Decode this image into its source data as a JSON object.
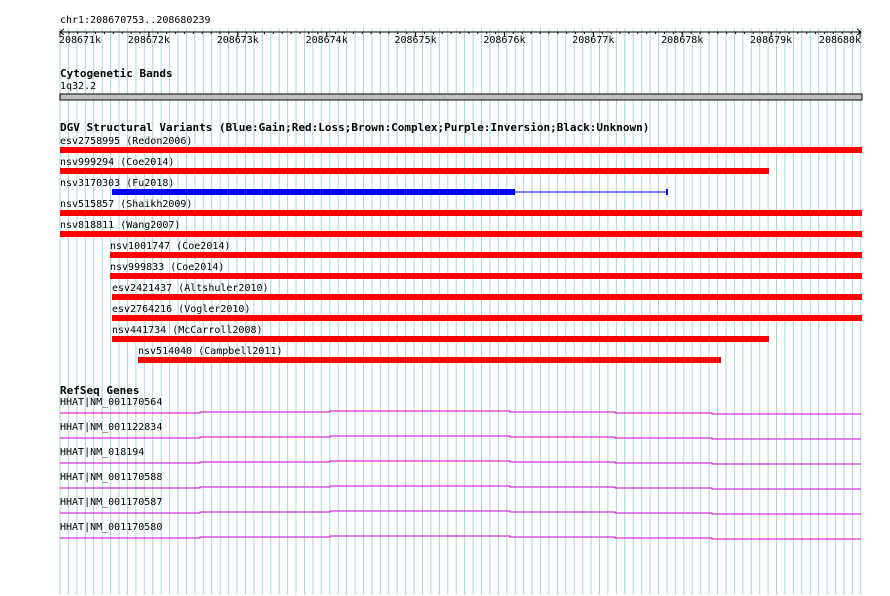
{
  "ruler": {
    "region": "chr1:208670753..208680239",
    "ticks": [
      "208671k",
      "208672k",
      "208673k",
      "208674k",
      "208675k",
      "208676k",
      "208677k",
      "208678k",
      "208679k",
      "208680k"
    ]
  },
  "cyto": {
    "title": "Cytogenetic Bands",
    "band": "1q32.2"
  },
  "dgv": {
    "title": "DGV Structural Variants (Blue:Gain;Red:Loss;Brown:Complex;Purple:Inversion;Black:Unknown)",
    "colors": {
      "gain": "#0000ff",
      "loss": "#ff0000"
    },
    "items": [
      {
        "label": "esv2758995 (Redon2006)",
        "type": "loss"
      },
      {
        "label": "nsv999294 (Coe2014)",
        "type": "loss"
      },
      {
        "label": "nsv3170303 (Fu2018)",
        "type": "gain"
      },
      {
        "label": "nsv515857 (Shaikh2009)",
        "type": "loss"
      },
      {
        "label": "nsv818811 (Wang2007)",
        "type": "loss"
      },
      {
        "label": "nsv1001747 (Coe2014)",
        "type": "loss"
      },
      {
        "label": "nsv999833 (Coe2014)",
        "type": "loss"
      },
      {
        "label": "esv2421437 (Altshuler2010)",
        "type": "loss"
      },
      {
        "label": "esv2764216 (Vogler2010)",
        "type": "loss"
      },
      {
        "label": "nsv441734 (McCarroll2008)",
        "type": "loss"
      },
      {
        "label": "nsv514040 (Campbell2011)",
        "type": "loss"
      }
    ]
  },
  "refseq": {
    "title": "RefSeq Genes",
    "color": "#cc00cc",
    "genes": [
      {
        "label": "HHAT|NM_001170564"
      },
      {
        "label": "HHAT|NM_001122834"
      },
      {
        "label": "HHAT|NM_018194"
      },
      {
        "label": "HHAT|NM_001170588"
      },
      {
        "label": "HHAT|NM_001170587"
      },
      {
        "label": "HHAT|NM_001170580"
      }
    ]
  }
}
